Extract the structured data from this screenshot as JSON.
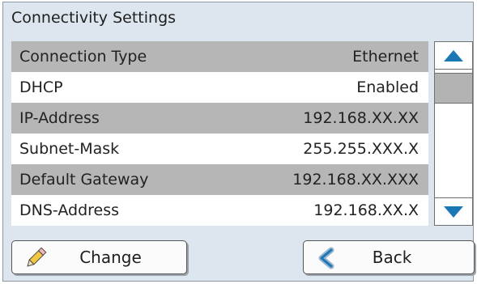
{
  "window": {
    "title": "Connectivity Settings"
  },
  "settings": {
    "rows": [
      {
        "label": "Connection Type",
        "value": "Ethernet"
      },
      {
        "label": "DHCP",
        "value": "Enabled"
      },
      {
        "label": "IP-Address",
        "value": "192.168.XX.XX"
      },
      {
        "label": "Subnet-Mask",
        "value": "255.255.XXX.X"
      },
      {
        "label": "Default Gateway",
        "value": "192.168.XX.XXX"
      },
      {
        "label": "DNS-Address",
        "value": "192.168.XX.X"
      }
    ]
  },
  "scrollbar": {
    "up_icon": "triangle-up-icon",
    "down_icon": "triangle-down-icon",
    "arrow_color": "#1b78b5"
  },
  "buttons": {
    "change": {
      "label": "Change",
      "icon": "pencil-icon"
    },
    "back": {
      "label": "Back",
      "icon": "back-arrow-icon"
    }
  },
  "colors": {
    "panel_bg": "#dde6ef",
    "row_shade": "#b6b6b6",
    "accent": "#1b78b5"
  }
}
